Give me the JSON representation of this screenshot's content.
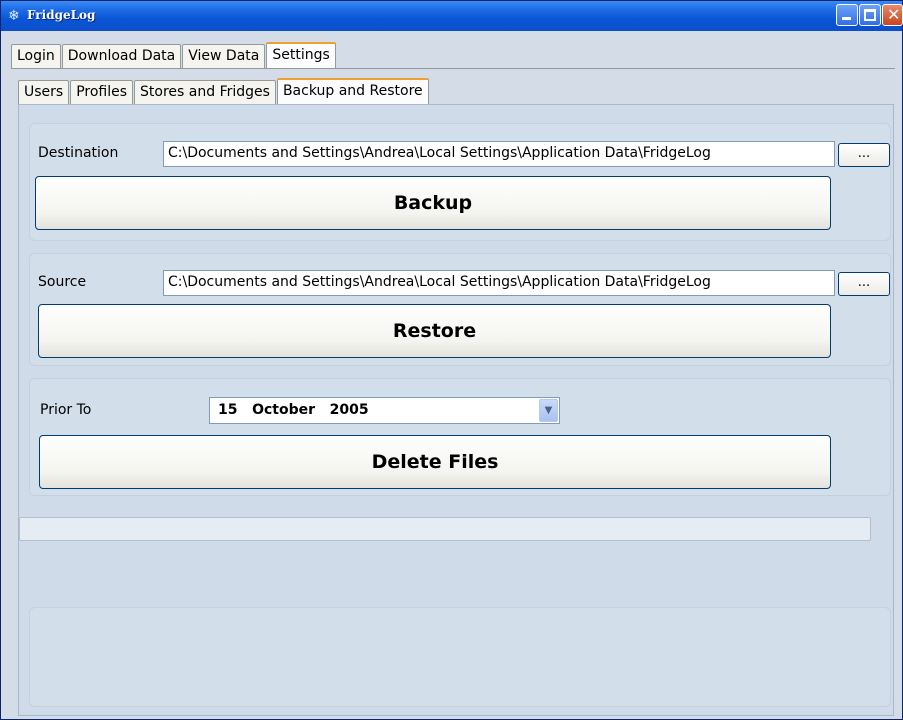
{
  "window": {
    "title": "FridgeLog",
    "app_icon": "snowflake-icon"
  },
  "main_tabs": [
    {
      "label": "Login",
      "active": false
    },
    {
      "label": "Download Data",
      "active": false
    },
    {
      "label": "View Data",
      "active": false
    },
    {
      "label": "Settings",
      "active": true
    }
  ],
  "sub_tabs": [
    {
      "label": "Users",
      "active": false
    },
    {
      "label": "Profiles",
      "active": false
    },
    {
      "label": "Stores and Fridges",
      "active": false
    },
    {
      "label": "Backup and Restore",
      "active": true
    }
  ],
  "backup": {
    "destination_label": "Destination",
    "destination_value": "C:\\Documents and Settings\\Andrea\\Local Settings\\Application Data\\FridgeLog",
    "browse_label": "...",
    "button_label": "Backup"
  },
  "restore": {
    "source_label": "Source",
    "source_value": "C:\\Documents and Settings\\Andrea\\Local Settings\\Application Data\\FridgeLog",
    "browse_label": "...",
    "button_label": "Restore"
  },
  "delete": {
    "prior_label": "Prior To",
    "date_value": "15   October   2005",
    "button_label": "Delete Files"
  },
  "progress": {
    "value": 0
  }
}
